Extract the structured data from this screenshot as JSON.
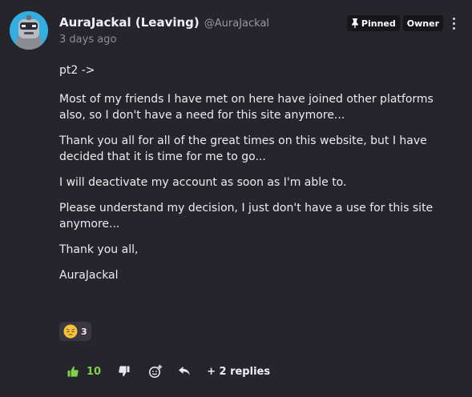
{
  "post": {
    "author_name": "AuraJackal (Leaving)",
    "author_handle": "@AuraJackal",
    "timestamp": "3 days ago",
    "badges": {
      "pinned": "Pinned",
      "owner": "Owner"
    },
    "paragraphs": [
      "pt2 ->",
      "Most of my friends I have met on here have joined other platforms also, so I don't have a need for this site anymore...",
      "Thank you all for all of the great times on this website, but I have decided that it is time for me to go...",
      "I will deactivate my account as soon as I'm able to.",
      "Please understand my decision, I just don't have a use for this site anymore...",
      "Thank you all,",
      "AuraJackal"
    ]
  },
  "reaction": {
    "emoji": "pensive-face",
    "count": "3"
  },
  "actions": {
    "like_count": "10",
    "replies_label": "+ 2 replies"
  },
  "colors": {
    "background": "#27252c",
    "avatar_ring": "#32aee0",
    "like_green": "#7ed14a",
    "badge_bg": "#17161b",
    "muted_text": "#9a97a3",
    "reaction_chip_bg": "#3a3740"
  }
}
